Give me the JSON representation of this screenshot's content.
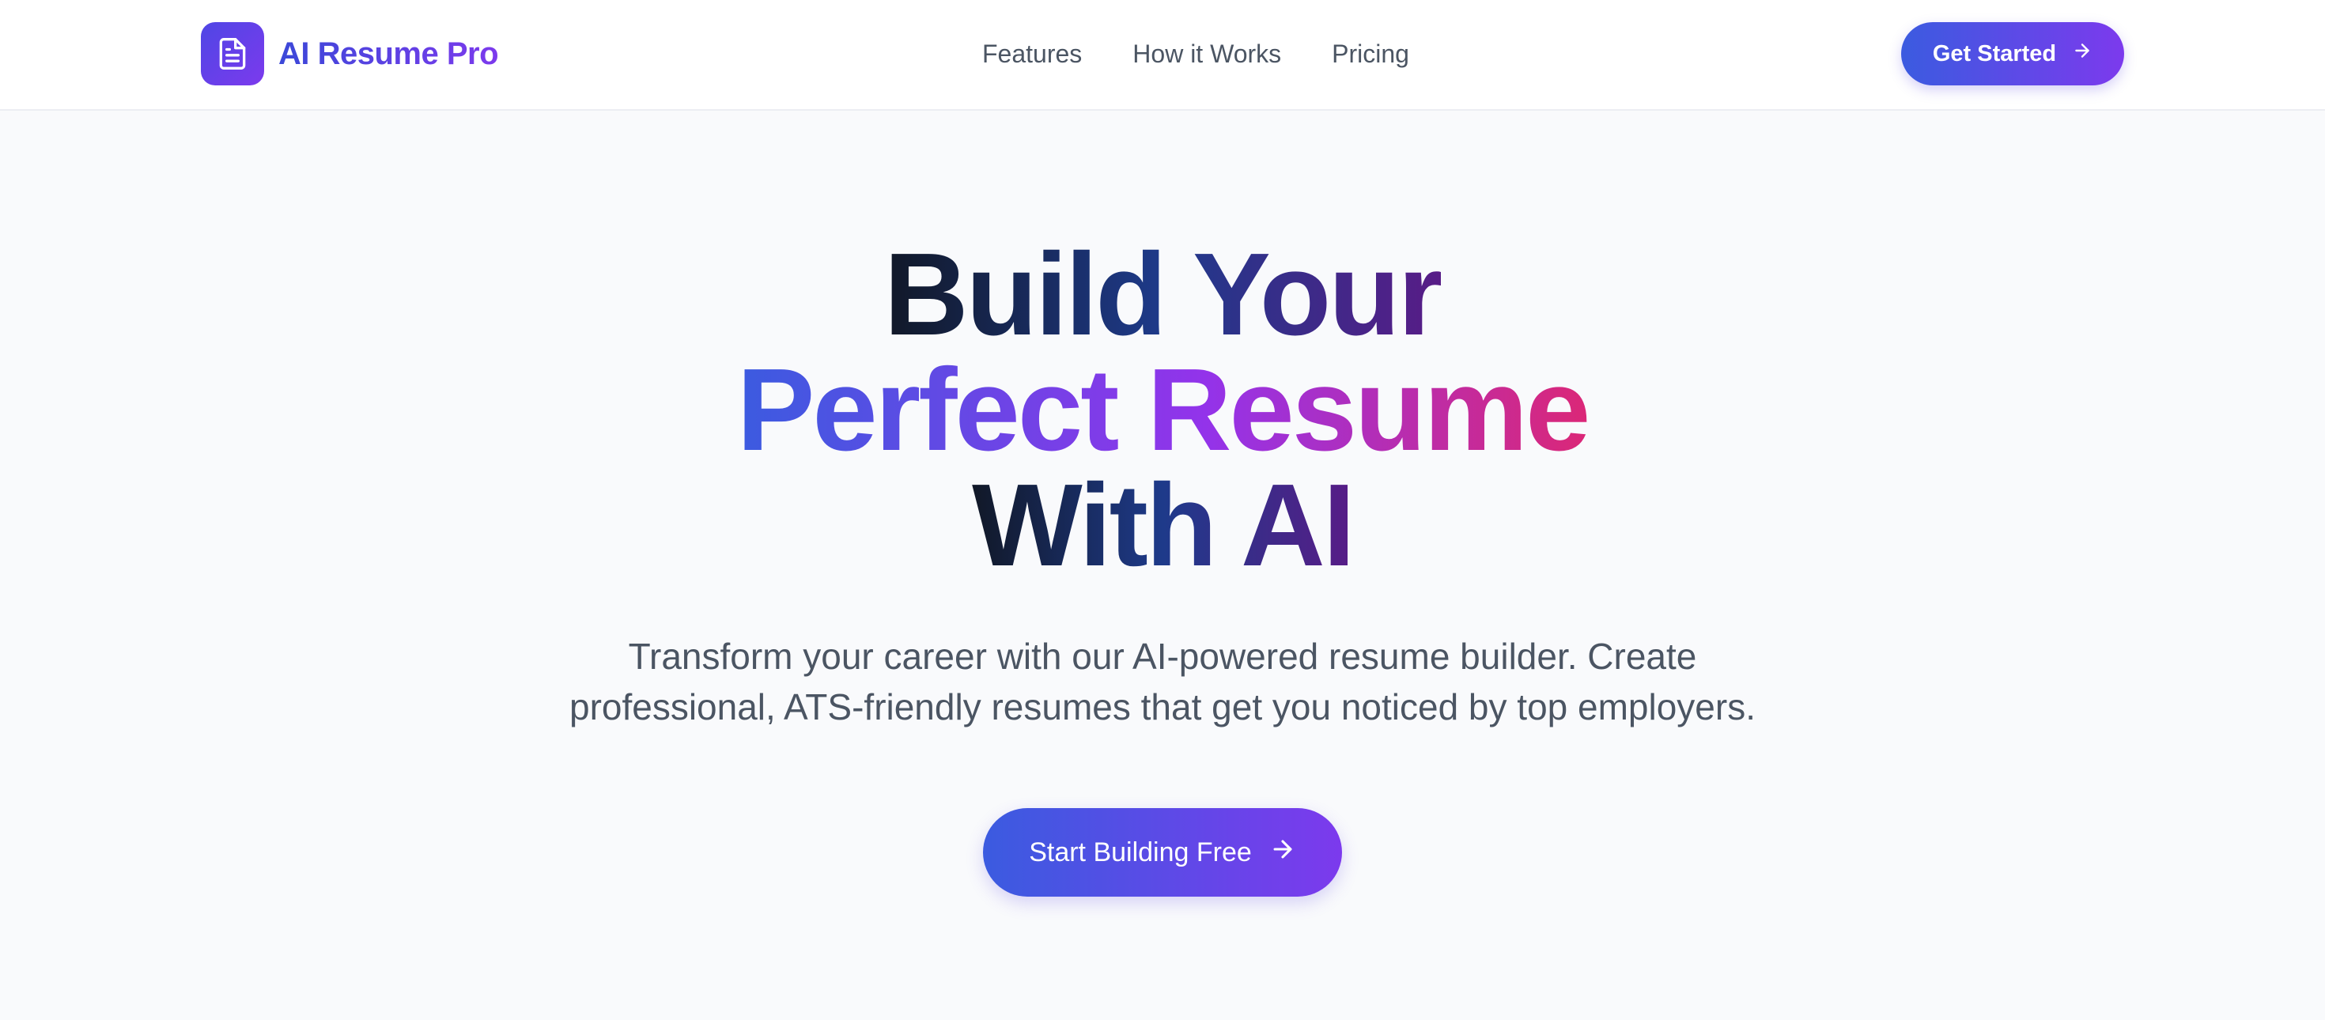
{
  "brand": {
    "name": "AI Resume Pro",
    "icon": "document-icon",
    "gradient_start": "#4f46e5",
    "gradient_end": "#7c3aed"
  },
  "nav": {
    "items": [
      {
        "label": "Features"
      },
      {
        "label": "How it Works"
      },
      {
        "label": "Pricing"
      }
    ]
  },
  "header_cta": {
    "label": "Get Started",
    "icon": "arrow-right-icon"
  },
  "hero": {
    "headline_line1": "Build Your",
    "headline_line2": "Perfect Resume",
    "headline_line3": "With AI",
    "subtitle_line1": "Transform your career with our AI-powered resume builder. Create",
    "subtitle_line2": "professional, ATS-friendly resumes that get you noticed by top employers.",
    "cta_label": "Start Building Free",
    "cta_icon": "arrow-right-icon"
  },
  "colors": {
    "accent_blue": "#3b5be0",
    "accent_purple": "#7c3aed",
    "accent_pink": "#db2777",
    "text_dark": "#111827",
    "text_muted": "#4b5563",
    "background": "#f9fafc"
  }
}
